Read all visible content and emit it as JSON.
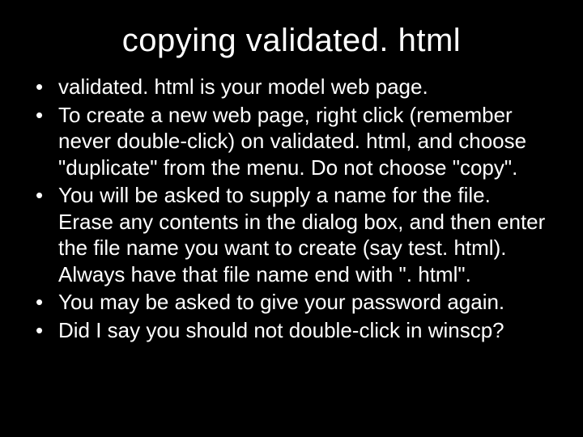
{
  "title": "copying validated. html",
  "bullets": [
    "validated. html is your model web page.",
    "To create a new web page, right click (remember never double-click) on validated. html, and choose \"duplicate\" from the menu. Do not choose \"copy\".",
    "You will be asked to supply a name for the file. Erase any contents in the dialog box, and then enter the file name you want to create (say test. html). Always have that file name end with \". html\".",
    "You may be asked to give your password again.",
    "Did I say you should not double-click in winscp?"
  ]
}
